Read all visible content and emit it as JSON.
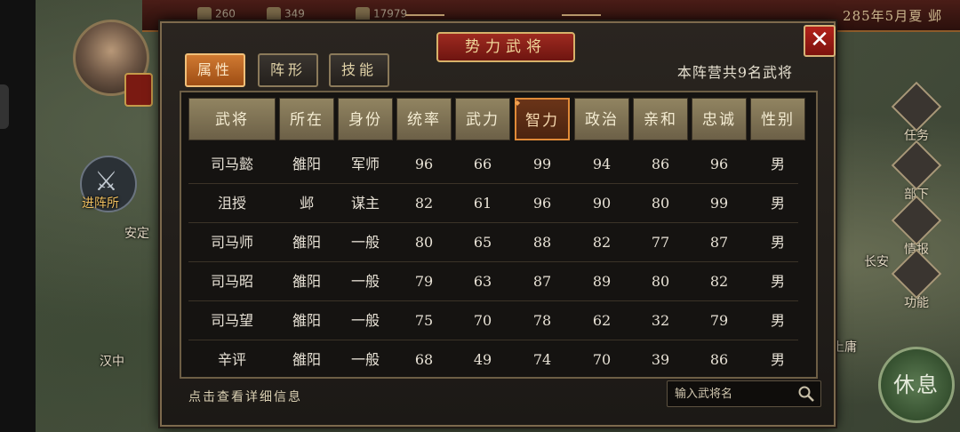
{
  "topbar": {
    "resources": [
      "260",
      "349",
      "17979"
    ],
    "date": "285年5月夏 邺"
  },
  "map": {
    "camp_label": "进阵所",
    "labels": [
      "安定",
      "汉中",
      "长安",
      "上庸"
    ],
    "side_menu": [
      "任务",
      "部下",
      "情报",
      "功能"
    ],
    "rest_button": "休息"
  },
  "panel": {
    "title": "势力武将",
    "tabs": [
      "属性",
      "阵形",
      "技能"
    ],
    "active_tab": "属性",
    "count_text": "本阵营共9名武将",
    "hint": "点击查看详细信息",
    "search_placeholder": "输入武将名",
    "columns": [
      "武将",
      "所在",
      "身份",
      "统率",
      "武力",
      "智力",
      "政治",
      "亲和",
      "忠诚",
      "性别"
    ],
    "sorted_column": "智力",
    "rows": [
      [
        "司马懿",
        "雒阳",
        "军师",
        "96",
        "66",
        "99",
        "94",
        "86",
        "96",
        "男"
      ],
      [
        "沮授",
        "邺",
        "谋主",
        "82",
        "61",
        "96",
        "90",
        "80",
        "99",
        "男"
      ],
      [
        "司马师",
        "雒阳",
        "一般",
        "80",
        "65",
        "88",
        "82",
        "77",
        "87",
        "男"
      ],
      [
        "司马昭",
        "雒阳",
        "一般",
        "79",
        "63",
        "87",
        "89",
        "80",
        "82",
        "男"
      ],
      [
        "司马望",
        "雒阳",
        "一般",
        "75",
        "70",
        "78",
        "62",
        "32",
        "79",
        "男"
      ],
      [
        "辛评",
        "雒阳",
        "一般",
        "68",
        "49",
        "74",
        "70",
        "39",
        "86",
        "男"
      ]
    ]
  },
  "colors": {
    "accent_orange": "#e08a38",
    "close_red": "#b3231b",
    "header_gold": "#918461"
  }
}
